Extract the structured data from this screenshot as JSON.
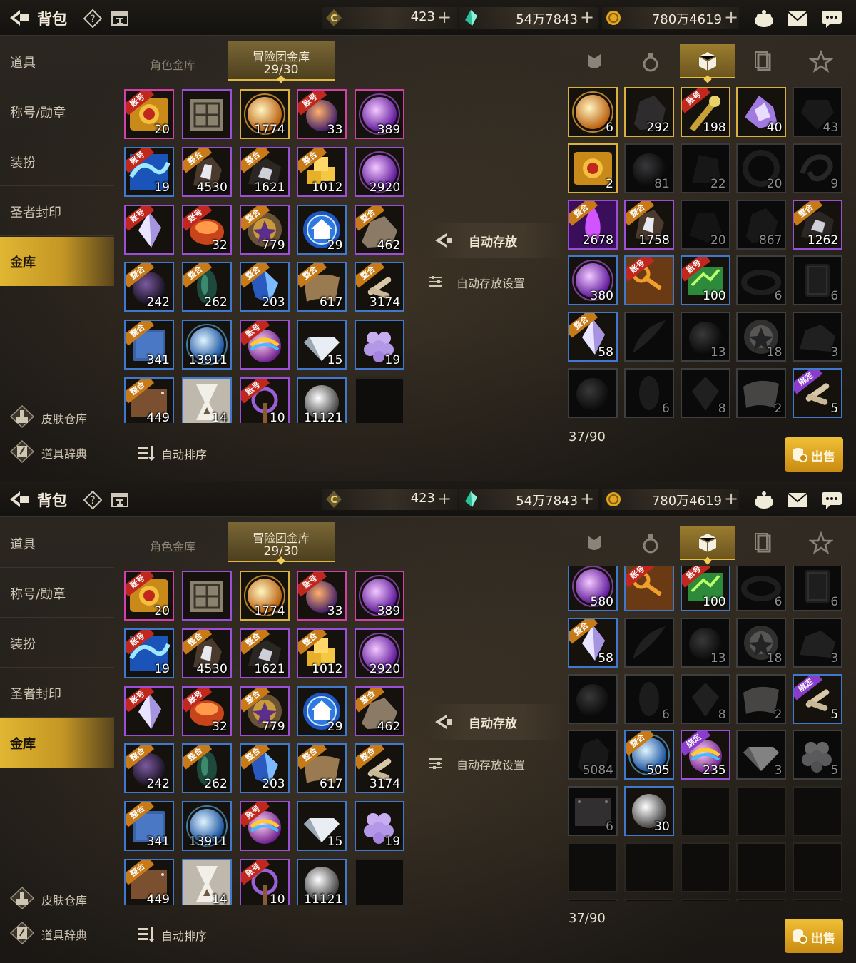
{
  "header": {
    "title": "背包",
    "currencies": [
      {
        "icon": "coin-c-icon",
        "value": "423"
      },
      {
        "icon": "green-crystal-icon",
        "value": "54万7843"
      },
      {
        "icon": "gold-coin-icon",
        "value": "780万4619"
      }
    ],
    "right_icons": [
      "cauldron-icon",
      "mail-icon",
      "chat-icon"
    ]
  },
  "sidebar": {
    "items": [
      "道具",
      "称号/勋章",
      "装扮",
      "圣者封印",
      "金库"
    ],
    "active": "金库",
    "links": [
      {
        "icon": "skin-warehouse-icon",
        "label": "皮肤仓库"
      },
      {
        "icon": "item-dictionary-icon",
        "label": "道具辞典"
      }
    ]
  },
  "vault_tabs": {
    "inactive": "角色金库",
    "active_title": "冒险团金库",
    "active_capacity": "29/30"
  },
  "actions": {
    "auto_store": "自动存放",
    "auto_store_settings": "自动存放设置",
    "auto_sort": "自动排序"
  },
  "inventory": {
    "tabs": [
      "equipment-tab-icon",
      "consumable-tab-icon",
      "material-tab-icon",
      "card-tab-icon",
      "emblem-tab-icon"
    ],
    "active_tab": "material-tab-icon",
    "count": "37/90",
    "sell": "出售"
  },
  "vault_items": [
    {
      "icon": "scroll-icon",
      "tag": "账号",
      "count": "20",
      "q": "pink"
    },
    {
      "icon": "box-icon",
      "tag": "",
      "count": "",
      "q": "purple"
    },
    {
      "icon": "sun-orb-icon",
      "tag": "",
      "count": "1774",
      "q": "gold"
    },
    {
      "icon": "orb-icon",
      "tag": "账号",
      "count": "33",
      "q": "pink"
    },
    {
      "icon": "purple-orb-icon",
      "tag": "",
      "count": "389",
      "q": "pink"
    },
    {
      "icon": "wave-icon",
      "tag": "账号",
      "count": "19",
      "q": "blue"
    },
    {
      "icon": "crystal-chunk-icon",
      "tag": "整合",
      "count": "4530",
      "q": "purple"
    },
    {
      "icon": "ore-icon",
      "tag": "整合",
      "count": "1621",
      "q": "purple"
    },
    {
      "icon": "gold-cubes-icon",
      "tag": "整合",
      "count": "1012",
      "q": "purple"
    },
    {
      "icon": "purple-orb-icon",
      "tag": "",
      "count": "2920",
      "q": "purple"
    },
    {
      "icon": "crystal-icon",
      "tag": "账号",
      "count": "",
      "q": "purple"
    },
    {
      "icon": "ember-icon",
      "tag": "账号",
      "count": "32",
      "q": "purple"
    },
    {
      "icon": "emblem-icon",
      "tag": "整合",
      "count": "779",
      "q": "purple"
    },
    {
      "icon": "home-icon",
      "tag": "",
      "count": "29",
      "q": "blue"
    },
    {
      "icon": "stone-icon",
      "tag": "整合",
      "count": "462",
      "q": "purple"
    },
    {
      "icon": "dark-orb-icon",
      "tag": "整合",
      "count": "242",
      "q": "blue"
    },
    {
      "icon": "green-shard-icon",
      "tag": "整合",
      "count": "262",
      "q": "blue"
    },
    {
      "icon": "blue-gem-icon",
      "tag": "整合",
      "count": "203",
      "q": "blue"
    },
    {
      "icon": "leather-icon",
      "tag": "整合",
      "count": "617",
      "q": "blue"
    },
    {
      "icon": "bones-icon",
      "tag": "整合",
      "count": "3174",
      "q": "blue"
    },
    {
      "icon": "book-icon",
      "tag": "整合",
      "count": "341",
      "q": "blue"
    },
    {
      "icon": "blue-orb-icon",
      "tag": "",
      "count": "13911",
      "q": "blue"
    },
    {
      "icon": "rainbow-orb-icon",
      "tag": "账号",
      "count": "",
      "q": "purple"
    },
    {
      "icon": "diamond-icon",
      "tag": "",
      "count": "15",
      "q": "blue"
    },
    {
      "icon": "grapes-icon",
      "tag": "",
      "count": "19",
      "q": "blue"
    },
    {
      "icon": "board-icon",
      "tag": "整合",
      "count": "449",
      "q": "blue"
    },
    {
      "icon": "hourglass-icon",
      "tag": "",
      "count": "14",
      "q": "blue"
    },
    {
      "icon": "staff-icon",
      "tag": "账号",
      "count": "10",
      "q": "purple"
    },
    {
      "icon": "white-orb-icon",
      "tag": "",
      "count": "11121",
      "q": "blue"
    },
    {
      "icon": "",
      "tag": "",
      "count": "",
      "q": "empty"
    }
  ],
  "inventory_items": [
    {
      "icon": "sun-orb-icon",
      "tag": "",
      "count": "6",
      "q": "gold",
      "dim": false
    },
    {
      "icon": "dark-stone-icon",
      "tag": "",
      "count": "292",
      "q": "gold",
      "dim": false
    },
    {
      "icon": "blade-icon",
      "tag": "账号",
      "count": "198",
      "q": "gold",
      "dim": false
    },
    {
      "icon": "purple-fragment-icon",
      "tag": "",
      "count": "40",
      "q": "gold",
      "dim": false
    },
    {
      "icon": "dark-gem-icon",
      "tag": "",
      "count": "43",
      "q": "pink",
      "dim": true
    },
    {
      "icon": "scroll-icon",
      "tag": "",
      "count": "2",
      "q": "gold",
      "dim": false
    },
    {
      "icon": "dark-orb-icon",
      "tag": "",
      "count": "81",
      "q": "purple",
      "dim": true
    },
    {
      "icon": "dark-shard-icon",
      "tag": "",
      "count": "22",
      "q": "purple",
      "dim": true
    },
    {
      "icon": "ring-icon",
      "tag": "",
      "count": "20",
      "q": "purple",
      "dim": true
    },
    {
      "icon": "swirl-icon",
      "tag": "",
      "count": "9",
      "q": "purple",
      "dim": true
    },
    {
      "icon": "purple-flame-icon",
      "tag": "整合",
      "count": "2678",
      "q": "purple",
      "dim": false
    },
    {
      "icon": "crystal-chunk-icon",
      "tag": "整合",
      "count": "1758",
      "q": "purple",
      "dim": false
    },
    {
      "icon": "dark-ore-icon",
      "tag": "",
      "count": "20",
      "q": "purple",
      "dim": true
    },
    {
      "icon": "dark-stone-icon",
      "tag": "",
      "count": "867",
      "q": "purple",
      "dim": true
    },
    {
      "icon": "ore-icon",
      "tag": "整合",
      "count": "1262",
      "q": "purple",
      "dim": false
    },
    {
      "icon": "purple-orb-icon",
      "tag": "",
      "count": "380",
      "q": "blue",
      "dim": false
    },
    {
      "icon": "key-icon",
      "tag": "账号",
      "count": "",
      "q": "blue",
      "dim": false
    },
    {
      "icon": "green-scroll-icon",
      "tag": "账号",
      "count": "100",
      "q": "blue",
      "dim": false
    },
    {
      "icon": "bracelet-icon",
      "tag": "",
      "count": "6",
      "q": "blue",
      "dim": true
    },
    {
      "icon": "card-icon",
      "tag": "",
      "count": "6",
      "q": "blue",
      "dim": true
    },
    {
      "icon": "crystal-icon",
      "tag": "整合",
      "count": "58",
      "q": "blue",
      "dim": false
    },
    {
      "icon": "feather-icon",
      "tag": "",
      "count": "",
      "q": "blue",
      "dim": true
    },
    {
      "icon": "dark-orb-icon",
      "tag": "",
      "count": "13",
      "q": "blue",
      "dim": true
    },
    {
      "icon": "emblem-icon",
      "tag": "",
      "count": "18",
      "q": "blue",
      "dim": true
    },
    {
      "icon": "rock-icon",
      "tag": "",
      "count": "3",
      "q": "blue",
      "dim": true
    },
    {
      "icon": "dark-orb-icon",
      "tag": "",
      "count": "",
      "q": "blue",
      "dim": true
    },
    {
      "icon": "leaf-icon",
      "tag": "",
      "count": "6",
      "q": "blue",
      "dim": true
    },
    {
      "icon": "gem-icon",
      "tag": "",
      "count": "8",
      "q": "blue",
      "dim": true
    },
    {
      "icon": "leather-icon",
      "tag": "",
      "count": "2",
      "q": "blue",
      "dim": true
    },
    {
      "icon": "bones-icon",
      "tag": "绑定",
      "count": "5",
      "q": "blue",
      "dim": false
    }
  ],
  "inventory_items_scrolled": [
    {
      "icon": "purple-orb-icon",
      "tag": "",
      "count": "580",
      "q": "blue",
      "dim": false
    },
    {
      "icon": "key-icon",
      "tag": "账号",
      "count": "",
      "q": "blue",
      "dim": false
    },
    {
      "icon": "green-scroll-icon",
      "tag": "账号",
      "count": "100",
      "q": "blue",
      "dim": false
    },
    {
      "icon": "bracelet-icon",
      "tag": "",
      "count": "6",
      "q": "blue",
      "dim": true
    },
    {
      "icon": "card-icon",
      "tag": "",
      "count": "6",
      "q": "blue",
      "dim": true
    },
    {
      "icon": "crystal-icon",
      "tag": "整合",
      "count": "58",
      "q": "blue",
      "dim": false
    },
    {
      "icon": "feather-icon",
      "tag": "",
      "count": "",
      "q": "blue",
      "dim": true
    },
    {
      "icon": "dark-orb-icon",
      "tag": "",
      "count": "13",
      "q": "blue",
      "dim": true
    },
    {
      "icon": "emblem-icon",
      "tag": "",
      "count": "18",
      "q": "blue",
      "dim": true
    },
    {
      "icon": "rock-icon",
      "tag": "",
      "count": "3",
      "q": "blue",
      "dim": true
    },
    {
      "icon": "dark-orb-icon",
      "tag": "",
      "count": "",
      "q": "blue",
      "dim": true
    },
    {
      "icon": "leaf-icon",
      "tag": "",
      "count": "6",
      "q": "blue",
      "dim": true
    },
    {
      "icon": "gem-icon",
      "tag": "",
      "count": "8",
      "q": "blue",
      "dim": true
    },
    {
      "icon": "leather-icon",
      "tag": "",
      "count": "2",
      "q": "blue",
      "dim": true
    },
    {
      "icon": "bones-icon",
      "tag": "绑定",
      "count": "5",
      "q": "blue",
      "dim": false
    },
    {
      "icon": "dark-stone-icon",
      "tag": "",
      "count": "5084",
      "q": "blue",
      "dim": true
    },
    {
      "icon": "blue-orb-icon",
      "tag": "整合",
      "count": "505",
      "q": "blue",
      "dim": false
    },
    {
      "icon": "rainbow-orb-icon",
      "tag": "绑定",
      "count": "235",
      "q": "purple",
      "dim": false
    },
    {
      "icon": "diamond-icon",
      "tag": "",
      "count": "3",
      "q": "blue",
      "dim": true
    },
    {
      "icon": "grapes-icon",
      "tag": "",
      "count": "5",
      "q": "blue",
      "dim": true
    },
    {
      "icon": "board-icon",
      "tag": "",
      "count": "6",
      "q": "blue",
      "dim": true
    },
    {
      "icon": "white-orb-icon",
      "tag": "",
      "count": "30",
      "q": "blue",
      "dim": false
    },
    {
      "icon": "",
      "tag": "",
      "count": "",
      "q": "empty",
      "dim": false
    },
    {
      "icon": "",
      "tag": "",
      "count": "",
      "q": "empty",
      "dim": false
    },
    {
      "icon": "",
      "tag": "",
      "count": "",
      "q": "empty",
      "dim": false
    },
    {
      "icon": "",
      "tag": "",
      "count": "",
      "q": "empty",
      "dim": false
    },
    {
      "icon": "",
      "tag": "",
      "count": "",
      "q": "empty",
      "dim": false
    },
    {
      "icon": "",
      "tag": "",
      "count": "",
      "q": "empty",
      "dim": false
    },
    {
      "icon": "",
      "tag": "",
      "count": "",
      "q": "empty",
      "dim": false
    },
    {
      "icon": "",
      "tag": "",
      "count": "",
      "q": "empty",
      "dim": false
    },
    {
      "icon": "",
      "tag": "",
      "count": "",
      "q": "empty",
      "dim": false
    },
    {
      "icon": "",
      "tag": "",
      "count": "",
      "q": "empty",
      "dim": false
    },
    {
      "icon": "",
      "tag": "",
      "count": "",
      "q": "empty",
      "dim": false
    },
    {
      "icon": "",
      "tag": "",
      "count": "",
      "q": "empty",
      "dim": false
    },
    {
      "icon": "",
      "tag": "",
      "count": "",
      "q": "empty",
      "dim": false
    }
  ],
  "colors": {
    "accent_gold": "#e0b632",
    "quality_blue": "#3f78cc",
    "quality_purple": "#9b4fd6",
    "quality_pink": "#d23fa8",
    "quality_gold": "#d9b13c"
  }
}
